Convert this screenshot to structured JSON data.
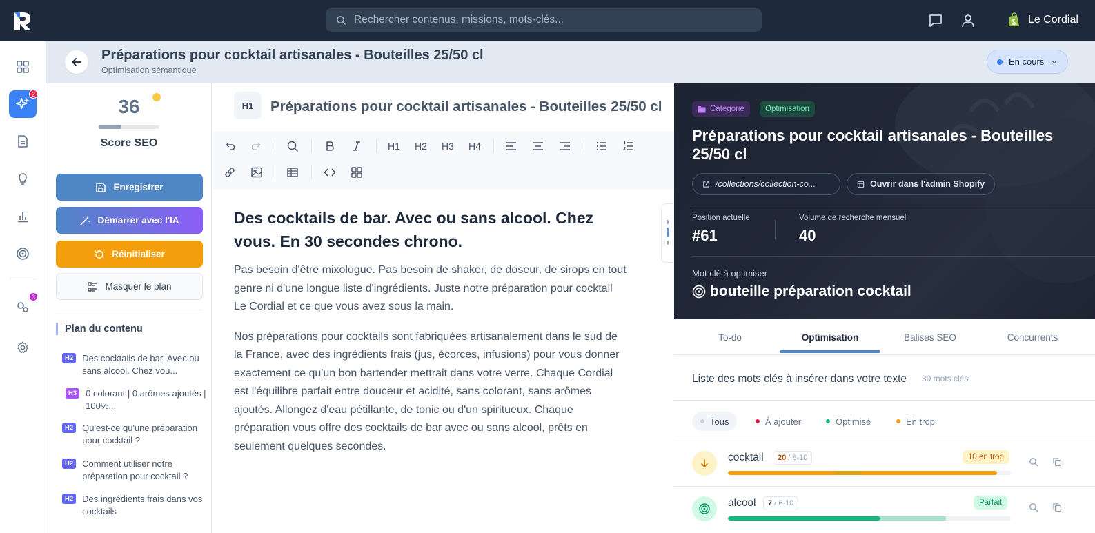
{
  "topbar": {
    "search_placeholder": "Rechercher contenus, missions, mots-clés...",
    "shop_name": "Le Cordial"
  },
  "sidebar": {
    "badges": {
      "missions": "2",
      "notifications": "3"
    }
  },
  "header": {
    "title": "Préparations pour cocktail artisanales - Bouteilles 25/50 cl",
    "subtitle": "Optimisation sémantique",
    "status": "En cours"
  },
  "score": {
    "value": "36",
    "label": "Score SEO",
    "fraction": 0.36
  },
  "actions": {
    "save": "Enregistrer",
    "ai": "Démarrer avec l'IA",
    "reset": "Réinitialiser",
    "hide_plan": "Masquer le plan"
  },
  "plan": {
    "title": "Plan du contenu",
    "items": [
      {
        "tag": "H2",
        "text": "Des cocktails de bar. Avec ou sans alcool. Chez vou..."
      },
      {
        "tag": "H3",
        "text": "0 colorant | 0 arômes ajoutés | 100%..."
      },
      {
        "tag": "H2",
        "text": "Qu'est-ce qu'une préparation pour cocktail ?"
      },
      {
        "tag": "H2",
        "text": "Comment utiliser notre préparation pour cocktail ?"
      },
      {
        "tag": "H2",
        "text": "Des ingrédients frais dans vos cocktails"
      }
    ]
  },
  "editor": {
    "h1_badge": "H1",
    "h1_title": "Préparations pour cocktail artisanales - Bouteilles 25/50 cl",
    "heading": "Des cocktails de bar. Avec ou sans alcool. Chez vous. En 30 secondes chrono.",
    "paragraphs": [
      "Pas besoin d'être mixologue. Pas besoin de shaker, de doseur, de sirops en tout genre ni d'une longue liste d'ingrédients. Juste notre préparation pour cocktail Le Cordial et ce que vous avez sous la main.",
      "Nos préparations pour cocktails sont fabriquées artisanalement dans le sud de la France, avec des ingrédients frais (jus, écorces, infusions) pour vous donner exactement ce qu'un bon bartender mettrait dans votre verre. Chaque Cordial est l'équilibre parfait entre douceur et acidité, sans colorant, sans arômes ajoutés. Allongez d'eau pétillante, de tonic ou d'un spiritueux. Chaque préparation vous offre des cocktails de bar avec ou sans alcool, prêts en seulement quelques secondes."
    ],
    "toolbar": {
      "h1": "H1",
      "h2": "H2",
      "h3": "H3",
      "h4": "H4"
    }
  },
  "panel": {
    "tag_category": "Catégorie",
    "tag_optimization": "Optimisation",
    "title": "Préparations pour cocktail artisanales - Bouteilles 25/50 cl",
    "url": "/collections/collection-co...",
    "shopify_button": "Ouvrir dans l'admin Shopify",
    "position_label": "Position actuelle",
    "position_value": "#61",
    "volume_label": "Volume de recherche mensuel",
    "volume_value": "40",
    "keyword_label": "Mot clé à optimiser",
    "keyword": "bouteille préparation cocktail",
    "tabs": [
      "To-do",
      "Optimisation",
      "Balises SEO",
      "Concurrents"
    ],
    "list_title": "Liste des mots clés à insérer dans votre texte",
    "list_count": "30 mots clés",
    "filters": [
      {
        "label": "Tous",
        "color": "#cbd5e1"
      },
      {
        "label": "À ajouter",
        "color": "#e11d48"
      },
      {
        "label": "Optimisé",
        "color": "#10b981"
      },
      {
        "label": "En trop",
        "color": "#f59e0b"
      }
    ],
    "keywords": [
      {
        "name": "cocktail",
        "count": "20",
        "range": "/ 8-10",
        "badge": "10 en trop",
        "status": "over",
        "fill": 0.95,
        "target_from": 0.38,
        "target_to": 0.47
      },
      {
        "name": "alcool",
        "count": "7",
        "range": "/ 6-10",
        "badge": "Parfait",
        "status": "ok",
        "fill": 0.54,
        "target_from": 0.54,
        "target_to": 0.77
      }
    ]
  },
  "colors": {
    "accent": "#4f86c6",
    "topbar": "#1e293b",
    "warning": "#f59e0b",
    "success": "#10b981"
  }
}
